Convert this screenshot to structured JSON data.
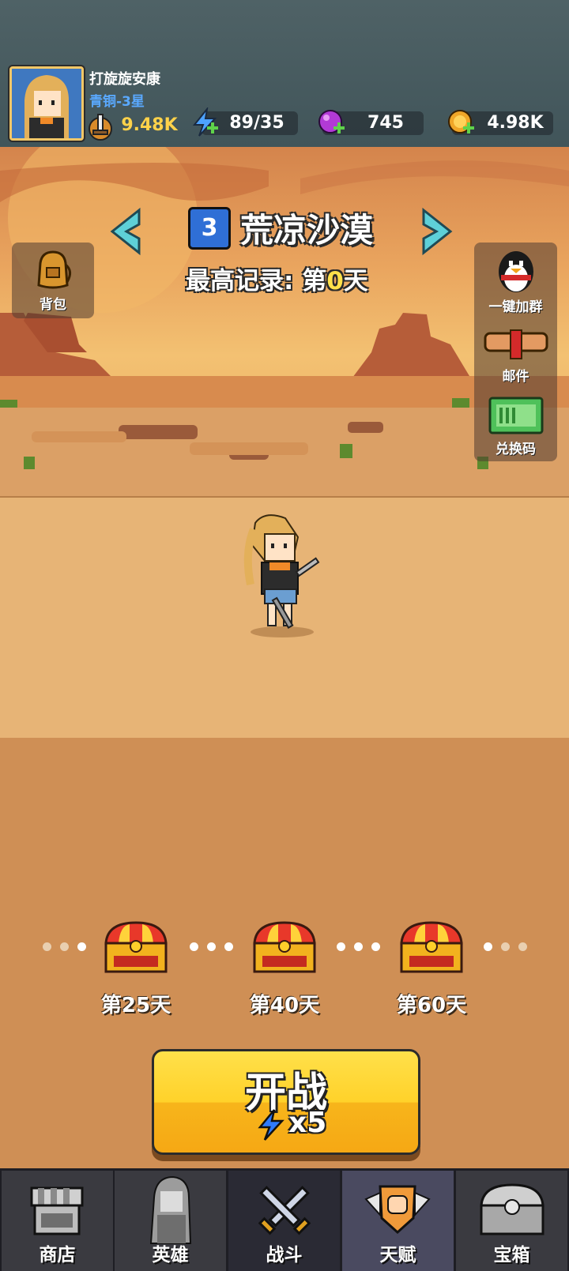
{
  "player": {
    "name": "打旋旋安康",
    "rank": "青铜-3星",
    "power": "9.48K",
    "energy": "89/35",
    "gems": "745",
    "gold": "4.98K"
  },
  "stage": {
    "number": "3",
    "name": "荒凉沙漠",
    "best_record_prefix": "最高记录: 第",
    "best_record_day": "0",
    "best_record_suffix": "天"
  },
  "side_buttons": {
    "backpack": "背包",
    "join_group": "一键加群",
    "mail": "邮件",
    "redeem_code": "兑换码"
  },
  "rewards": [
    {
      "label": "第25天"
    },
    {
      "label": "第40天"
    },
    {
      "label": "第60天"
    }
  ],
  "start": {
    "label": "开战",
    "cost": "x5"
  },
  "nav": [
    {
      "label": "商店"
    },
    {
      "label": "英雄"
    },
    {
      "label": "战斗"
    },
    {
      "label": "天赋"
    },
    {
      "label": "宝箱"
    }
  ],
  "colors": {
    "accent_gold": "#ffd22a",
    "rank_blue": "#5aa9ff",
    "record_yellow": "#ffe14a"
  }
}
